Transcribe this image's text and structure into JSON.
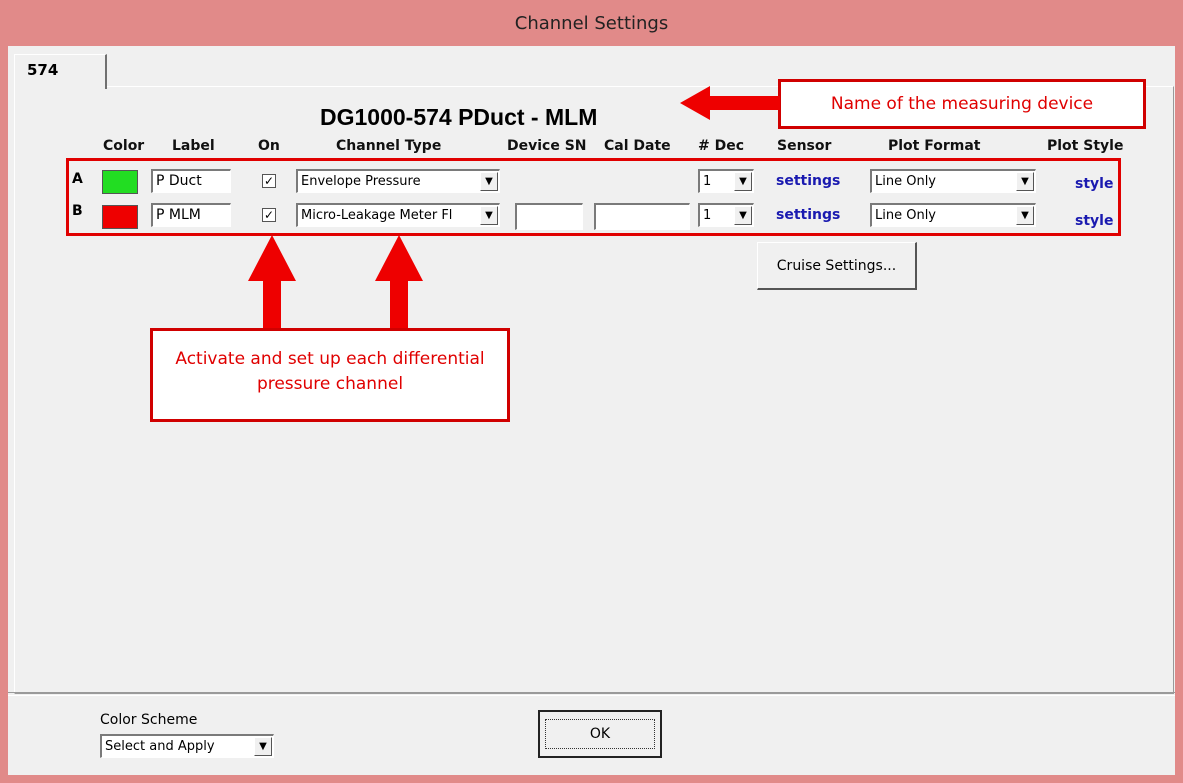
{
  "window": {
    "title": "Channel Settings"
  },
  "tab": {
    "label": "574"
  },
  "device_name": "DG1000-574 PDuct - MLM",
  "headers": {
    "color": "Color",
    "label": "Label",
    "on": "On",
    "channel_type": "Channel Type",
    "device_sn": "Device SN",
    "cal_date": "Cal Date",
    "dec": "# Dec",
    "sensor": "Sensor",
    "plot_format": "Plot Format",
    "plot_style": "Plot Style"
  },
  "rows": [
    {
      "id": "A",
      "color": "#22dd22",
      "label": "P Duct",
      "on": "✓",
      "channel_type": "Envelope Pressure",
      "dec": "1",
      "sensor": "settings",
      "plot_format": "Line Only",
      "plot_style": "style"
    },
    {
      "id": "B",
      "color": "#ee0000",
      "label": "P MLM",
      "on": "✓",
      "channel_type": "Micro-Leakage Meter Fl",
      "device_sn": "",
      "cal_date": "",
      "dec": "1",
      "sensor": "settings",
      "plot_format": "Line Only",
      "plot_style": "style"
    }
  ],
  "cruise_button": "Cruise Settings...",
  "color_scheme": {
    "label": "Color Scheme",
    "value": "Select and Apply"
  },
  "ok_button": "OK",
  "annotations": {
    "device_name_note": "Name of the measuring device",
    "channels_note": "Activate and set up each differential pressure channel"
  },
  "icons": {
    "dropdown": "chevron-down-icon",
    "checkbox": "checkmark-icon"
  },
  "colors": {
    "annotation_red": "#e00000",
    "title_bar": "#e18a89"
  }
}
